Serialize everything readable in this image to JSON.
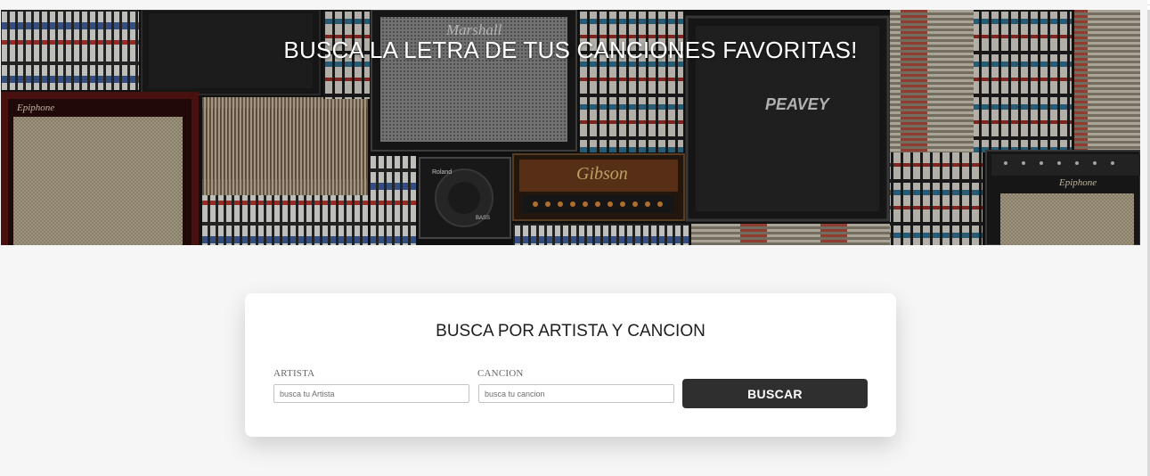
{
  "hero": {
    "title": "BUSCA LA LETRA DE TUS CANCIONES FAVORITAS!",
    "background_image": "wall of guitar amplifiers, records and cassette tapes",
    "brand_marks": {
      "epiphone_left": "Epiphone",
      "marshall": "Marshall",
      "peavey": "PEAVEY",
      "roland": "Roland",
      "roland_model": "BASS",
      "gibson": "Gibson",
      "epiphone_right": "Epiphone"
    }
  },
  "search_card": {
    "title": "BUSCA POR ARTISTA Y CANCION",
    "artist_label": "ARTISTA",
    "artist_placeholder": "busca tu Artista",
    "artist_value": "",
    "song_label": "CANCION",
    "song_placeholder": "busca tu cancion",
    "song_value": "",
    "submit_label": "BUSCAR"
  },
  "colors": {
    "page_background": "#f6f6f6",
    "card_background": "#ffffff",
    "button_background": "#2f2f2f",
    "button_text": "#ffffff",
    "hero_text": "#ffffff"
  }
}
